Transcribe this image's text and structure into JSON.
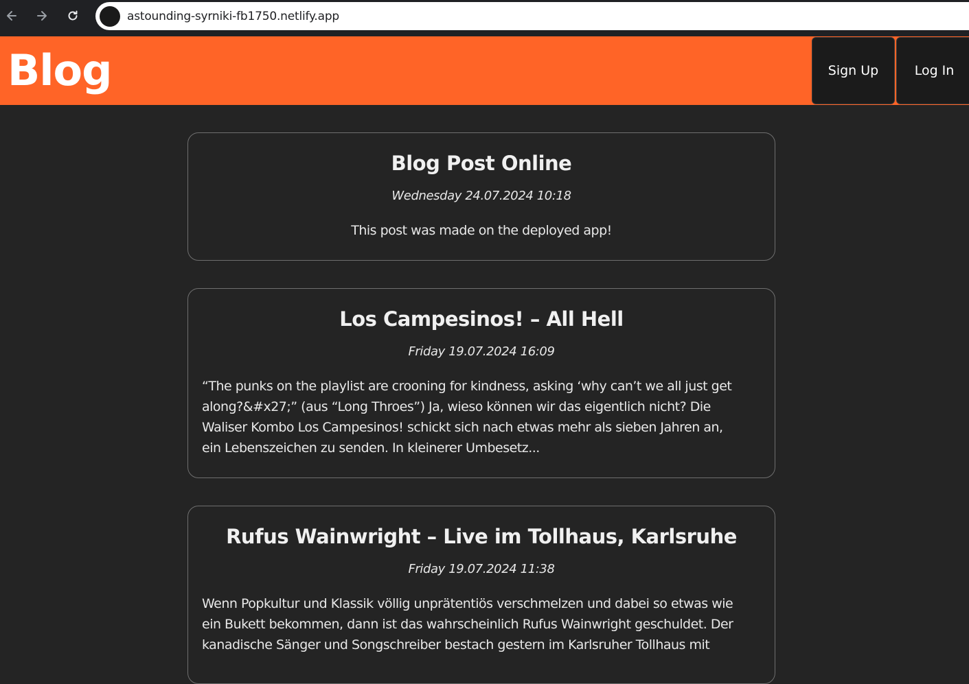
{
  "browser": {
    "url": "astounding-syrniki-fb1750.netlify.app",
    "back_icon": "arrow-left-icon",
    "forward_icon": "arrow-right-icon",
    "reload_icon": "reload-icon"
  },
  "header": {
    "title": "Blog",
    "signup_label": "Sign Up",
    "login_label": "Log In",
    "accent_color": "#ff6427"
  },
  "posts": [
    {
      "title": "Blog Post Online",
      "date": "Wednesday 24.07.2024 10:18",
      "excerpt": "This post was made on the deployed app!"
    },
    {
      "title": "Los Campesinos! – All Hell",
      "date": "Friday 19.07.2024 16:09",
      "excerpt_lines": [
        "“The punks on the playlist are crooning for kindness, asking ‘why can’t we all just get",
        "along?&#x27;” (aus “Long Throes”) Ja, wieso können wir das eigentlich nicht? Die",
        "Waliser Kombo Los Campesinos! schickt sich nach etwas mehr als sieben Jahren an,",
        "ein Lebenszeichen zu senden. In kleinerer Umbesetz..."
      ]
    },
    {
      "title": "Rufus Wainwright – Live im Tollhaus, Karlsruhe",
      "date": "Friday 19.07.2024 11:38",
      "excerpt_lines": [
        "Wenn Popkultur und Klassik völlig unprätentiös verschmelzen und dabei so etwas wie",
        "ein Bukett bekommen, dann ist das wahrscheinlich Rufus Wainwright geschuldet. Der",
        "kanadische Sänger und Songschreiber bestach gestern im Karlsruher Tollhaus mit"
      ]
    }
  ]
}
